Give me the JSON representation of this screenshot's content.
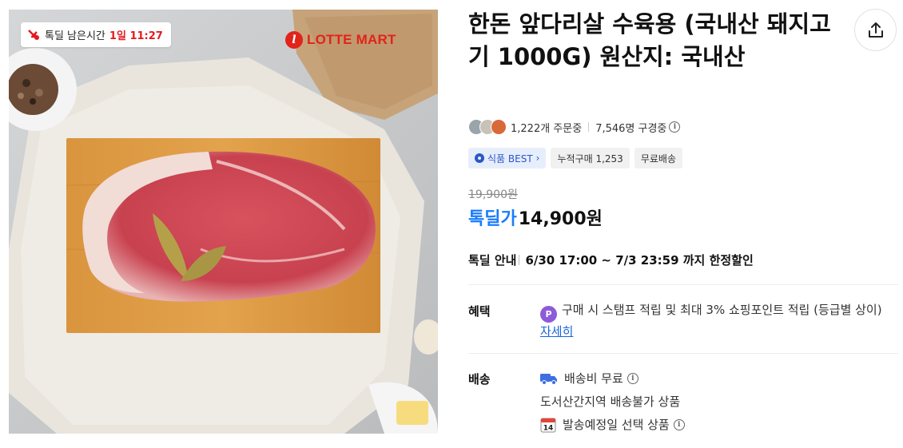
{
  "image": {
    "timer_badge": {
      "label": "톡딜 남은시간",
      "time": "1일 11:27"
    },
    "brand": "LOTTE MART"
  },
  "product": {
    "title": "한돈 앞다리살 수육용 (국내산 돼지고기 1000G) 원산지: 국내산",
    "order_count": "1,222개 주문중",
    "watch_count": "7,546명 구경중",
    "tags": {
      "best": "식품 BEST",
      "cumulative": "누적구매 1,253",
      "free_shipping": "무료배송"
    },
    "original_price": "19,900원",
    "deal_label": "톡딜가",
    "sale_price": "14,900원"
  },
  "deal_info": {
    "label": "톡딜 안내",
    "period": "6/30 17:00 ~ 7/3 23:59 까지 한정할인"
  },
  "benefit": {
    "label": "혜택",
    "text": "구매 시 스탬프 적립 및 최대 3% 쇼핑포인트 적립 (등급별 상이)",
    "link": "자세히"
  },
  "shipping": {
    "label": "배송",
    "fee": "배송비 무료",
    "restriction": "도서산간지역 배송불가 상품",
    "schedule": "발송예정일 선택 상품",
    "calendar_day": "14"
  },
  "icons": {
    "share": "share-icon",
    "deal_timer": "deal-logo-icon",
    "truck": "truck-icon",
    "calendar": "calendar-icon",
    "point": "point-icon"
  },
  "colors": {
    "deal_blue": "#1a7cff",
    "timer_red": "#e5191f",
    "brand_red": "#e2231a",
    "link_blue": "#1a66d9"
  }
}
